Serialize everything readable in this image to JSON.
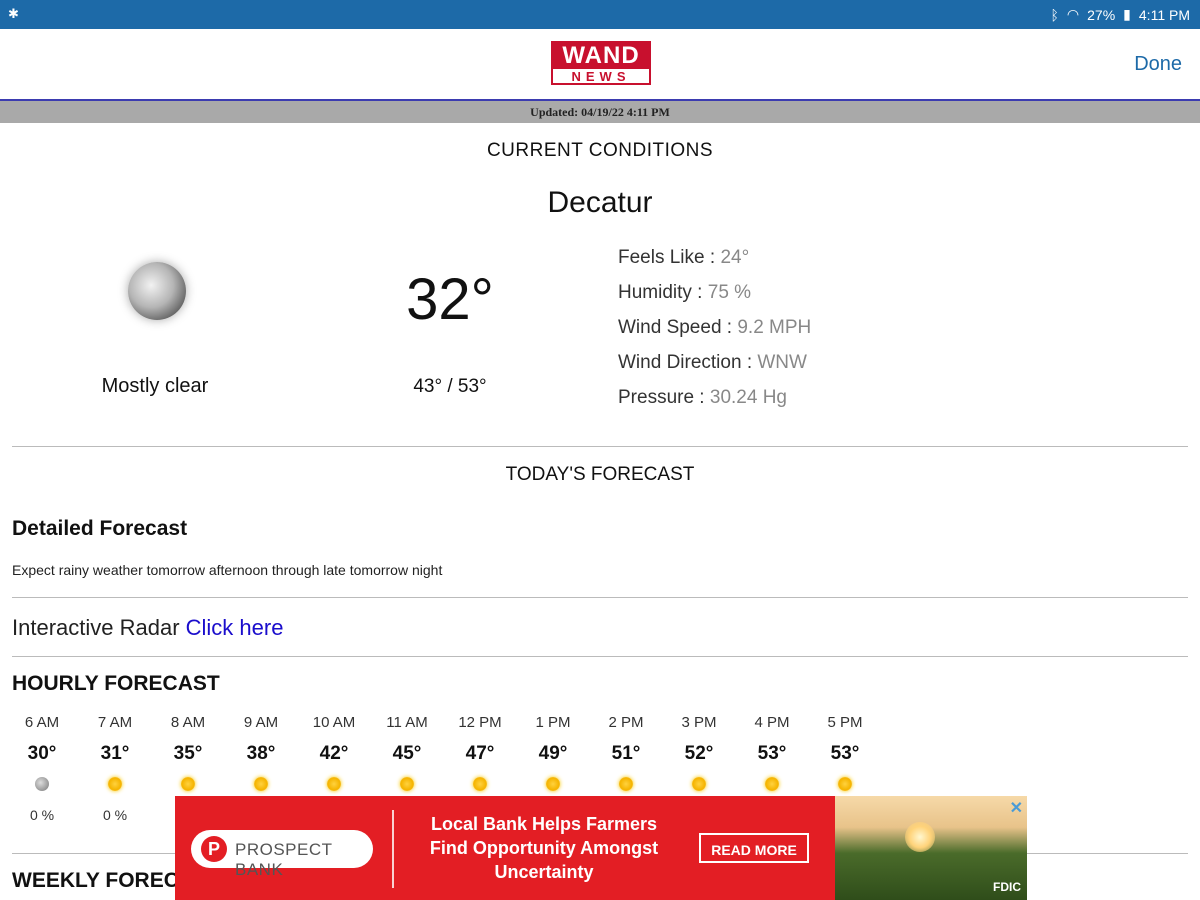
{
  "status_bar": {
    "left_icon": "notification-icon",
    "battery": "27%",
    "time": "4:11 PM"
  },
  "header": {
    "logo_top": "WAND",
    "logo_bottom": "NEWS",
    "done_label": "Done"
  },
  "updated": "Updated: 04/19/22 4:11 PM",
  "current": {
    "title": "CURRENT CONDITIONS",
    "city": "Decatur",
    "icon": "moon-icon",
    "condition": "Mostly clear",
    "temp": "32°",
    "hilo": "43° / 53°",
    "details": [
      {
        "label": "Feels Like : ",
        "value": "24°"
      },
      {
        "label": "Humidity : ",
        "value": "75 %"
      },
      {
        "label": "Wind Speed : ",
        "value": "9.2 MPH"
      },
      {
        "label": "Wind Direction : ",
        "value": "WNW"
      },
      {
        "label": "Pressure : ",
        "value": "30.24 Hg"
      }
    ]
  },
  "today": {
    "title": "TODAY'S FORECAST",
    "detailed_title": "Detailed Forecast",
    "detailed_text": "Expect rainy weather tomorrow afternoon through late tomorrow night",
    "radar_label": "Interactive Radar ",
    "radar_link": "Click here"
  },
  "hourly": {
    "title": "HOURLY FORECAST",
    "hours": [
      {
        "time": "6 AM",
        "temp": "30°",
        "icon": "moon",
        "precip": "0 %"
      },
      {
        "time": "7 AM",
        "temp": "31°",
        "icon": "sun",
        "precip": "0 %"
      },
      {
        "time": "8 AM",
        "temp": "35°",
        "icon": "sun",
        "precip": ""
      },
      {
        "time": "9 AM",
        "temp": "38°",
        "icon": "sun",
        "precip": ""
      },
      {
        "time": "10 AM",
        "temp": "42°",
        "icon": "sun",
        "precip": ""
      },
      {
        "time": "11 AM",
        "temp": "45°",
        "icon": "sun",
        "precip": ""
      },
      {
        "time": "12 PM",
        "temp": "47°",
        "icon": "sun",
        "precip": ""
      },
      {
        "time": "1 PM",
        "temp": "49°",
        "icon": "sun",
        "precip": ""
      },
      {
        "time": "2 PM",
        "temp": "51°",
        "icon": "sun",
        "precip": ""
      },
      {
        "time": "3 PM",
        "temp": "52°",
        "icon": "sun",
        "precip": ""
      },
      {
        "time": "4 PM",
        "temp": "53°",
        "icon": "sun",
        "precip": ""
      },
      {
        "time": "5 PM",
        "temp": "53°",
        "icon": "sun",
        "precip": ""
      }
    ]
  },
  "weekly": {
    "title": "WEEKLY FOREC"
  },
  "ad": {
    "brand_initial": "P",
    "brand": "PROSPECT BANK",
    "headline": "Local Bank Helps Farmers Find Opportunity Amongst Uncertainty",
    "cta": "READ MORE",
    "close": "✕",
    "badge": "FDIC"
  }
}
